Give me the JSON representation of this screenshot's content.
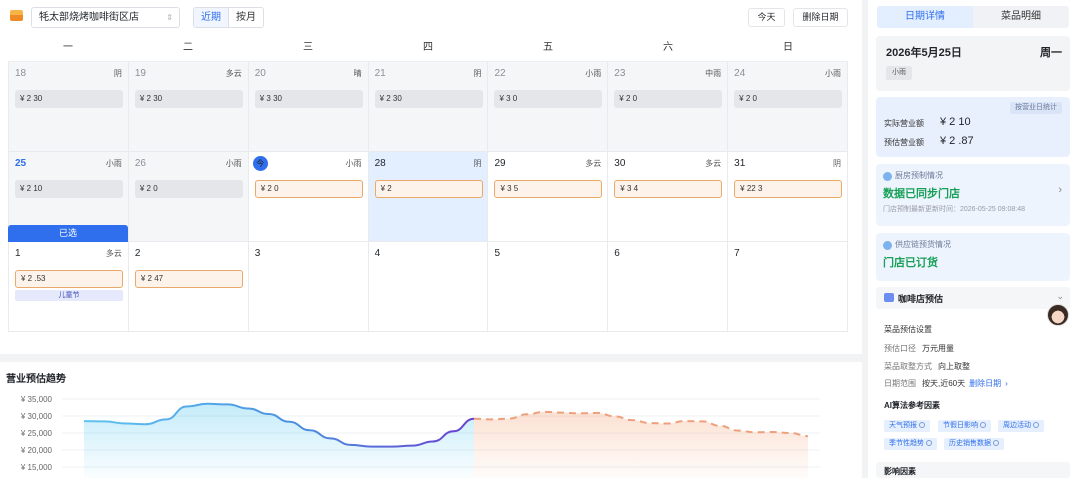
{
  "toolbar": {
    "store_name": "牦太部烧烤咖啡街区店",
    "view_recent": "近期",
    "view_month": "按月",
    "today_button": "今天",
    "clear_dates_button": "删除日期"
  },
  "calendar": {
    "weekdays": [
      "一",
      "二",
      "三",
      "四",
      "五",
      "六",
      "日"
    ],
    "chosen_label": "已选",
    "rows": [
      [
        {
          "day": "18",
          "weather": "阴",
          "amount": "¥ 2   30"
        },
        {
          "day": "19",
          "weather": "多云",
          "amount": "¥ 2   30"
        },
        {
          "day": "20",
          "weather": "晴",
          "amount": "¥ 3   30"
        },
        {
          "day": "21",
          "weather": "阴",
          "amount": "¥ 2   30"
        },
        {
          "day": "22",
          "weather": "小雨",
          "amount": "¥ 3   0"
        },
        {
          "day": "23",
          "weather": "中雨",
          "amount": "¥ 2   0"
        },
        {
          "day": "24",
          "weather": "小雨",
          "amount": "¥ 2   0"
        }
      ],
      [
        {
          "day": "25",
          "weather": "小雨",
          "amount": "¥ 2   10"
        },
        {
          "day": "26",
          "weather": "小雨",
          "amount": "¥ 2   0"
        },
        {
          "day": "今",
          "weather": "小雨",
          "amount": "¥ 2   0"
        },
        {
          "day": "28",
          "weather": "阴",
          "amount": "¥ 2"
        },
        {
          "day": "29",
          "weather": "多云",
          "amount": "¥ 3   5"
        },
        {
          "day": "30",
          "weather": "多云",
          "amount": "¥ 3   4"
        },
        {
          "day": "31",
          "weather": "阴",
          "amount": "¥ 22   3"
        }
      ],
      [
        {
          "day": "1",
          "weather": "多云",
          "amount": "¥ 2   .53",
          "holiday": "儿童节"
        },
        {
          "day": "2",
          "weather": "",
          "amount": "¥ 2   47"
        },
        {
          "day": "3",
          "weather": ""
        },
        {
          "day": "4",
          "weather": ""
        },
        {
          "day": "5",
          "weather": ""
        },
        {
          "day": "6",
          "weather": ""
        },
        {
          "day": "7",
          "weather": ""
        }
      ]
    ]
  },
  "trend": {
    "title": "营业预估趋势",
    "chart_data": {
      "type": "area",
      "title": "营业预估趋势",
      "ylim": [
        15000,
        35000
      ],
      "yticks": [
        "¥ 35,000",
        "¥ 30,000",
        "¥ 25,000",
        "¥ 20,000",
        "¥ 15,000"
      ],
      "series": [
        {
          "values": [
            28500,
            28400,
            27800,
            27600,
            29000,
            32800,
            33600,
            33400,
            32200,
            30600,
            28300,
            25800,
            23400,
            21500,
            21000,
            21000,
            21300,
            22500,
            25500,
            29200
          ]
        },
        {
          "values": [
            29200,
            29000,
            29200,
            30500,
            31200,
            31000,
            30800,
            30900,
            29900,
            28800,
            27900,
            27800,
            28500,
            28400,
            27100,
            25700,
            25200,
            25300,
            25000,
            24100
          ]
        }
      ]
    }
  },
  "panel": {
    "tab_detail": "日期详情",
    "tab_dishes": "菜品明细",
    "date": "2026年5月25日",
    "weekday": "周一",
    "weather": "小雨",
    "revenue_tag": "按营业日统计",
    "actual_label": "实际营业额",
    "actual_value": "¥ 2      10",
    "forecast_label": "预估营业额",
    "forecast_value": "¥ 2 .87",
    "kitchen_head": "厨房预制情况",
    "kitchen_status": "数据已同步门店",
    "kitchen_sub": "门店预制最新更新时间：2026-05-25 09:08:48",
    "supply_head": "供应链预货情况",
    "supply_status": "门店已订货",
    "section_title": "咖啡店预估",
    "settings_title": "菜品预估设置",
    "caliber_label": "预估口径",
    "caliber_value": "万元用量",
    "rounding_label": "菜品取整方式",
    "rounding_value": "向上取整",
    "range_label": "日期范围",
    "range_value": "按天,近60天",
    "range_link": "删除日期",
    "factors_title": "AI算法参考因素",
    "factors": [
      "天气预报",
      "节假日影响",
      "周边活动",
      "季节性趋势",
      "历史销售数据"
    ],
    "influence_title": "影响因素"
  }
}
